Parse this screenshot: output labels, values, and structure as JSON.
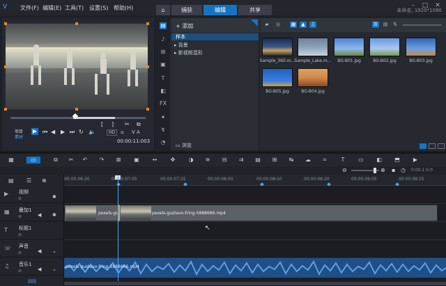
{
  "menubar": {
    "items": [
      "文件(F)",
      "编辑(E)",
      "工具(T)",
      "设置(S)",
      "帮助(H)"
    ],
    "tabs": [
      "捕获",
      "编辑",
      "共享"
    ],
    "active_tab": "编辑",
    "project_title": "未命名, 1920*1080"
  },
  "player": {
    "mode_project": "项目",
    "mode_clip": "素材",
    "timecode": "00:00:11:003",
    "letters": "V A"
  },
  "library": {
    "add_label": "添加",
    "folders": [
      "样本",
      "背景",
      "影视频混形"
    ],
    "selected_folder": "样本",
    "browse_label": "浏览",
    "media": [
      {
        "name": "Sample_360.m...",
        "thumb": "#3a5a8a"
      },
      {
        "name": "Sample_Lake.m...",
        "thumb": "#8aa3b8"
      },
      {
        "name": "BG-B01.jpg",
        "thumb": "#5d8fd6"
      },
      {
        "name": "BG-B02.jpg",
        "thumb": "#6a9be0"
      },
      {
        "name": "BG-B03.jpg",
        "thumb": "#3f79c8"
      },
      {
        "name": "BG-B05.jpg",
        "thumb": "#2c6fd0"
      },
      {
        "name": "BG-B04.jpg",
        "thumb": "#d08a4a"
      }
    ]
  },
  "timeline": {
    "zoom_time": "0:00:1:5:0",
    "ruler_ticks": [
      "00:00:06:20",
      "00:00:07:05",
      "00:00:07:15",
      "00:00:08:00",
      "00:00:08:10",
      "00:00:08:20",
      "00:00:09:05",
      "00:00:09:15"
    ],
    "tracks": [
      {
        "name": "视频",
        "icon": "video-track-icon"
      },
      {
        "name": "叠加1",
        "icon": "overlay-track-icon"
      },
      {
        "name": "标题1",
        "icon": "title-track-icon"
      },
      {
        "name": "声音",
        "icon": "voice-track-icon"
      },
      {
        "name": "音乐1",
        "icon": "music-track-icon"
      }
    ],
    "clip1_label": "pexels-gu",
    "clip2_label": "pexels-gustavo-fring-5888666.mp4",
    "audio_label": "pexels-gustavo-fring-5888666.mp4"
  },
  "colors": {
    "accent": "#1474c4",
    "audio": "#1f4f86",
    "waveform": "#4d8fd8"
  }
}
